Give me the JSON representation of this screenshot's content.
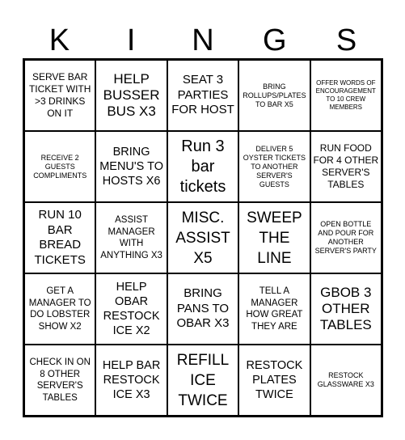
{
  "title_letters": [
    "K",
    "I",
    "N",
    "G",
    "S"
  ],
  "cells": [
    [
      "SERVE BAR TICKET WITH >3 DRINKS ON IT",
      "HELP BUSSER BUS X3",
      "SEAT 3 PARTIES FOR HOST",
      "BRING ROLLUPS/PLATES TO BAR X5",
      "OFFER WORDS OF ENCOURAGEMENT TO 10 CREW MEMBERS"
    ],
    [
      "RECEIVE 2 GUESTS COMPLIMENTS",
      "BRING MENU'S TO HOSTS X6",
      "Run 3 bar tickets",
      "DELIVER 5 OYSTER TICKETS TO ANOTHER SERVER'S GUESTS",
      "RUN FOOD FOR 4 OTHER SERVER'S TABLES"
    ],
    [
      "RUN 10 BAR BREAD TICKETS",
      "ASSIST MANAGER WITH ANYTHING X3",
      "MISC. ASSIST X5",
      "SWEEP THE LINE",
      "OPEN BOTTLE AND POUR FOR ANOTHER SERVER'S PARTY"
    ],
    [
      "GET A MANAGER TO DO LOBSTER SHOW X2",
      "HELP OBAR RESTOCK ICE X2",
      "BRING PANS TO OBAR X3",
      "TELL A MANAGER HOW GREAT THEY ARE",
      "GBOB 3 OTHER TABLES"
    ],
    [
      "CHECK IN ON 8 OTHER SERVER'S TABLES",
      "HELP BAR RESTOCK ICE X3",
      "REFILL ICE TWICE",
      "RESTOCK PLATES TWICE",
      "RESTOCK GLASSWARE X3"
    ]
  ]
}
